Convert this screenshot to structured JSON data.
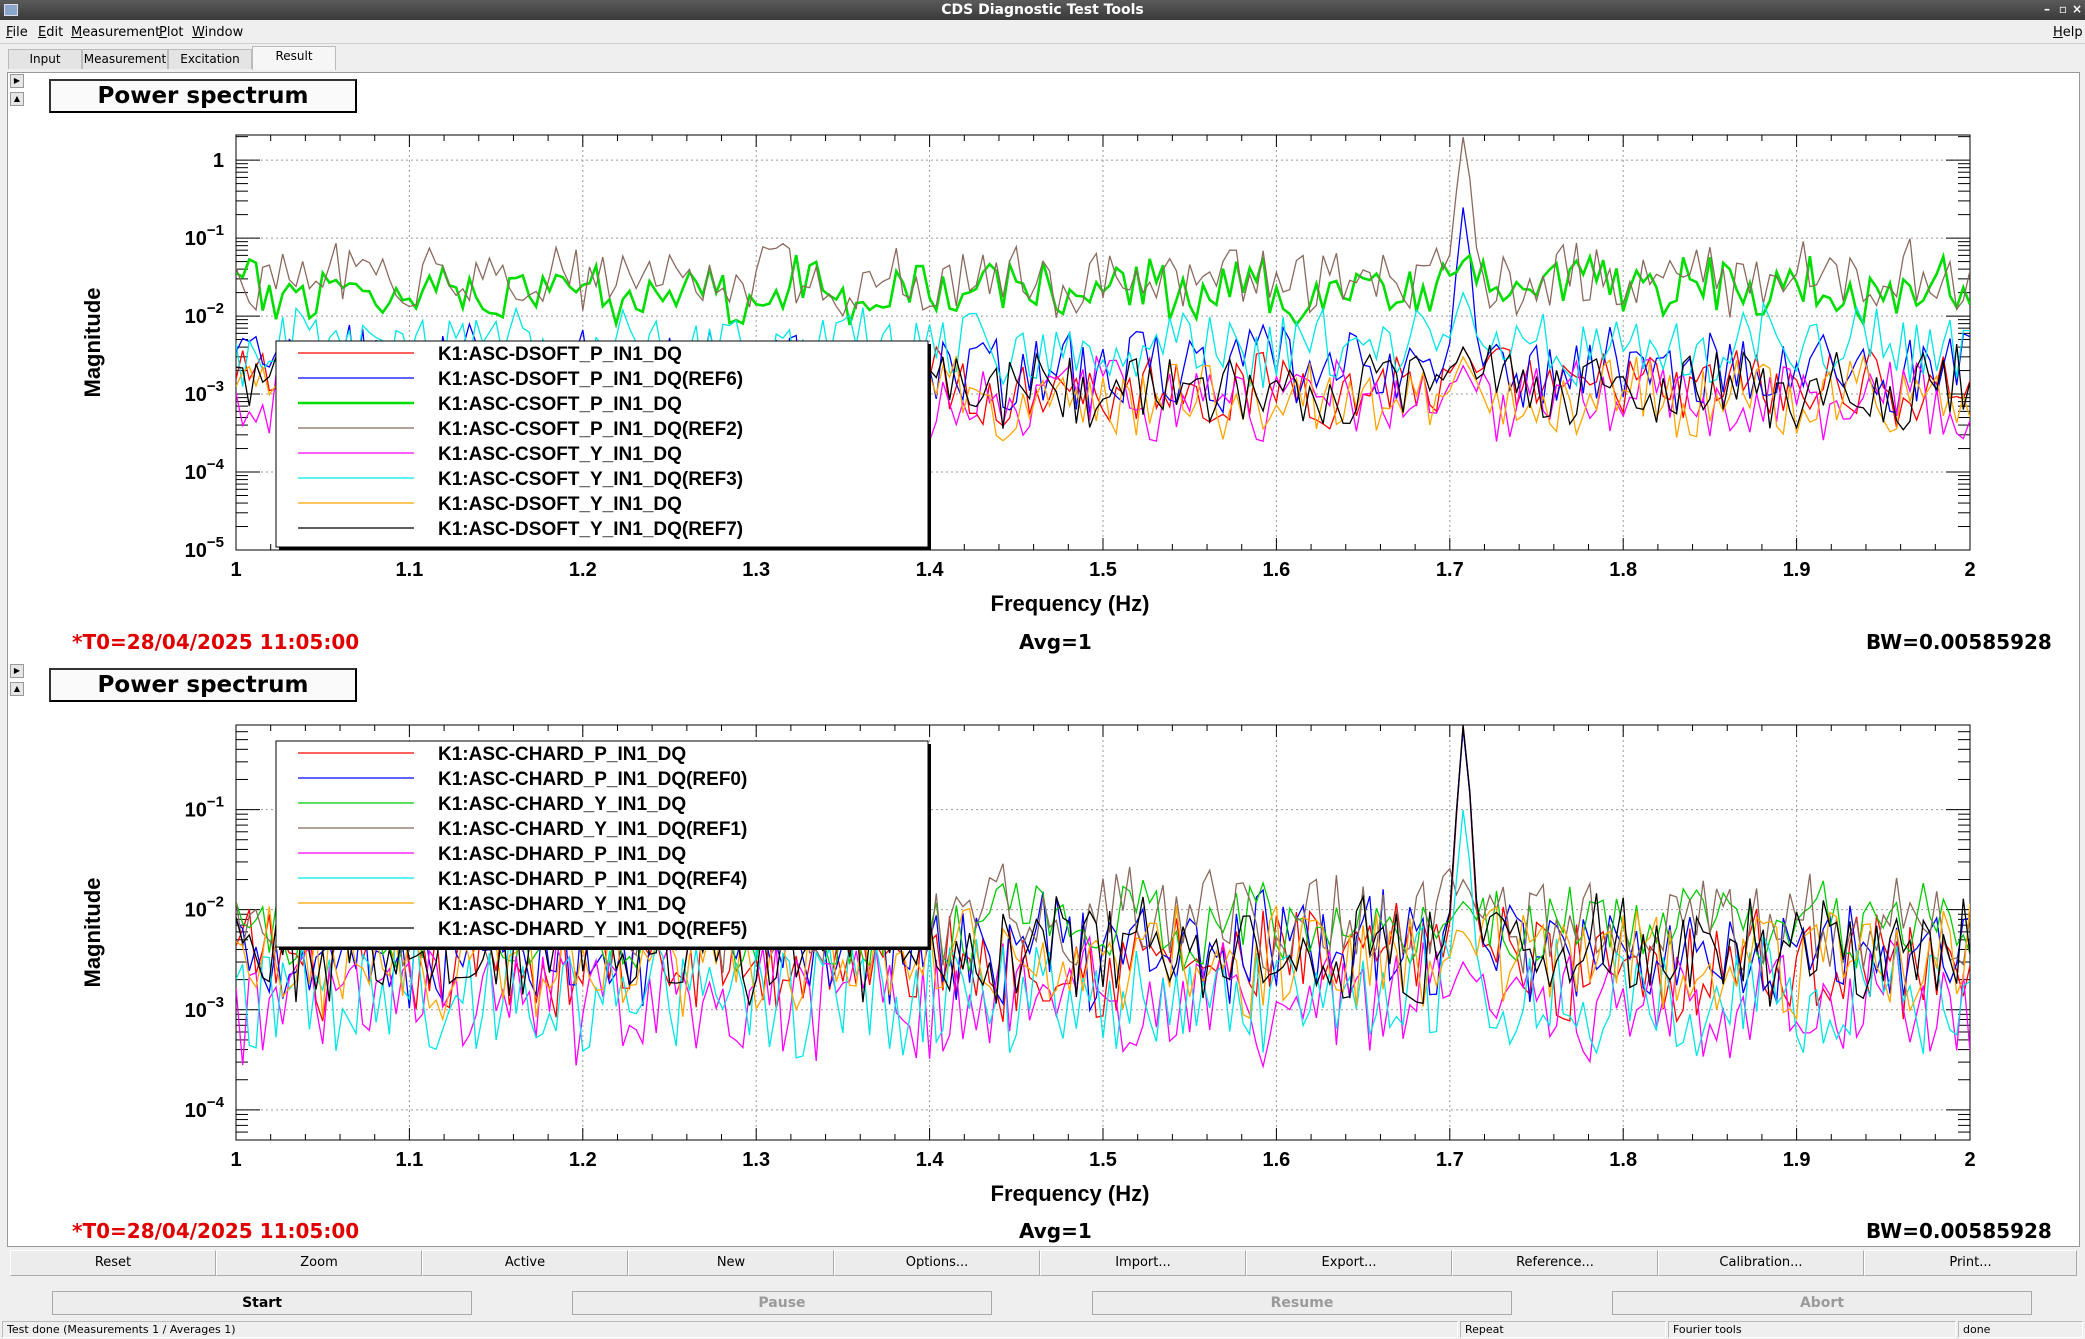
{
  "window": {
    "title": "CDS Diagnostic Test Tools"
  },
  "menu": [
    "File",
    "Edit",
    "Measurement",
    "Plot",
    "Window"
  ],
  "help_label": "Help",
  "tabs": [
    {
      "label": "Input",
      "active": false
    },
    {
      "label": "Measurement",
      "active": false
    },
    {
      "label": "Excitation",
      "active": false
    },
    {
      "label": "Result",
      "active": true
    }
  ],
  "panels": [
    {
      "title": "Power spectrum",
      "t0": "*T0=28/04/2025 11:05:00",
      "avg": "Avg=1",
      "bw": "BW=0.00585928",
      "chart_data": {
        "type": "line",
        "xlabel": "Frequency (Hz)",
        "ylabel": "Magnitude",
        "xlim": [
          1,
          2
        ],
        "ylim": [
          1e-05,
          2.1
        ],
        "yscale": "log",
        "xticks": [
          "1",
          "1.1",
          "1.2",
          "1.3",
          "1.4",
          "1.5",
          "1.6",
          "1.7",
          "1.8",
          "1.9",
          "2"
        ],
        "yticks": [
          {
            "value": 1,
            "base": "1",
            "exp": ""
          },
          {
            "value": 0.1,
            "base": "10",
            "exp": "−1"
          },
          {
            "value": 0.01,
            "base": "10",
            "exp": "−2"
          },
          {
            "value": 0.001,
            "base": "10",
            "exp": "−3"
          },
          {
            "value": 0.0001,
            "base": "10",
            "exp": "−4"
          },
          {
            "value": 1e-05,
            "base": "10",
            "exp": "−5"
          }
        ],
        "grid": true,
        "legend_position": "top-left",
        "series": [
          {
            "name": "K1:ASC-DSOFT_P_IN1_DQ",
            "color": "#ff0000",
            "base": 0.0012,
            "var": 0.45,
            "peak": 0.004
          },
          {
            "name": "K1:ASC-DSOFT_P_IN1_DQ(REF6)",
            "color": "#0000ff",
            "base": 0.002,
            "var": 0.5,
            "peak": 0.25
          },
          {
            "name": "K1:ASC-CSOFT_P_IN1_DQ",
            "color": "#00dd00",
            "base": 0.022,
            "var": 0.35,
            "peak": 0.05
          },
          {
            "name": "K1:ASC-CSOFT_P_IN1_DQ(REF2)",
            "color": "#8b6a5e",
            "base": 0.03,
            "var": 0.4,
            "peak": 2.0
          },
          {
            "name": "K1:ASC-CSOFT_Y_IN1_DQ",
            "color": "#ff00ff",
            "base": 0.0009,
            "var": 0.45,
            "peak": 0.002
          },
          {
            "name": "K1:ASC-CSOFT_Y_IN1_DQ(REF3)",
            "color": "#00e5e5",
            "base": 0.004,
            "var": 0.45,
            "peak": 0.02
          },
          {
            "name": "K1:ASC-DSOFT_Y_IN1_DQ",
            "color": "#ffa500",
            "base": 0.0009,
            "var": 0.45,
            "peak": 0.003
          },
          {
            "name": "K1:ASC-DSOFT_Y_IN1_DQ(REF7)",
            "color": "#000000",
            "base": 0.0012,
            "var": 0.45,
            "peak": 0.004
          }
        ]
      }
    },
    {
      "title": "Power spectrum",
      "t0": "*T0=28/04/2025 11:05:00",
      "avg": "Avg=1",
      "bw": "BW=0.00585928",
      "chart_data": {
        "type": "line",
        "xlabel": "Frequency (Hz)",
        "ylabel": "Magnitude",
        "xlim": [
          1,
          2
        ],
        "ylim": [
          5e-05,
          0.7
        ],
        "yscale": "log",
        "xticks": [
          "1",
          "1.1",
          "1.2",
          "1.3",
          "1.4",
          "1.5",
          "1.6",
          "1.7",
          "1.8",
          "1.9",
          "2"
        ],
        "yticks": [
          {
            "value": 0.1,
            "base": "10",
            "exp": "−1"
          },
          {
            "value": 0.01,
            "base": "10",
            "exp": "−2"
          },
          {
            "value": 0.001,
            "base": "10",
            "exp": "−3"
          },
          {
            "value": 0.0001,
            "base": "10",
            "exp": "−4"
          }
        ],
        "grid": true,
        "legend_position": "top-left",
        "series": [
          {
            "name": "K1:ASC-CHARD_P_IN1_DQ",
            "color": "#ff0000",
            "base": 0.003,
            "var": 0.5,
            "peak": 0.7
          },
          {
            "name": "K1:ASC-CHARD_P_IN1_DQ(REF0)",
            "color": "#0000ff",
            "base": 0.004,
            "var": 0.5,
            "peak": 0.65
          },
          {
            "name": "K1:ASC-CHARD_Y_IN1_DQ",
            "color": "#00cc00",
            "base": 0.007,
            "var": 0.35,
            "peak": 0.012
          },
          {
            "name": "K1:ASC-CHARD_Y_IN1_DQ(REF1)",
            "color": "#8b6a5e",
            "base": 0.008,
            "var": 0.45,
            "peak": 0.02
          },
          {
            "name": "K1:ASC-DHARD_P_IN1_DQ",
            "color": "#ff00ff",
            "base": 0.0012,
            "var": 0.55,
            "peak": 0.003
          },
          {
            "name": "K1:ASC-DHARD_P_IN1_DQ(REF4)",
            "color": "#00e5e5",
            "base": 0.0015,
            "var": 0.55,
            "peak": 0.1
          },
          {
            "name": "K1:ASC-DHARD_Y_IN1_DQ",
            "color": "#ffa500",
            "base": 0.003,
            "var": 0.5,
            "peak": 0.006
          },
          {
            "name": "K1:ASC-DHARD_Y_IN1_DQ(REF5)",
            "color": "#000000",
            "base": 0.004,
            "var": 0.5,
            "peak": 0.7
          }
        ]
      }
    }
  ],
  "toolbar": [
    "Reset",
    "Zoom",
    "Active",
    "New",
    "Options...",
    "Import...",
    "Export...",
    "Reference...",
    "Calibration...",
    "Print..."
  ],
  "controls": [
    {
      "label": "Start",
      "enabled": true
    },
    {
      "label": "Pause",
      "enabled": false
    },
    {
      "label": "Resume",
      "enabled": false
    },
    {
      "label": "Abort",
      "enabled": false
    }
  ],
  "status": {
    "message": "Test done (Measurements 1 / Averages 1)",
    "repeat": "Repeat",
    "fourier": "Fourier tools",
    "state": "done"
  }
}
